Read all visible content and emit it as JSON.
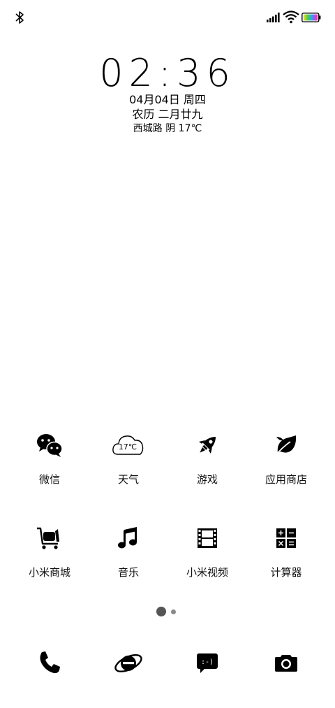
{
  "status_bar": {
    "bluetooth_icon": "bluetooth-icon",
    "signal_icon": "signal-icon",
    "wifi_icon": "wifi-icon",
    "battery_icon": "battery-icon"
  },
  "clock": {
    "time": "02:36",
    "date": "04月04日 周四",
    "lunar": "农历 二月廿九",
    "weather": "西城路 阴 17℃"
  },
  "apps_row1": [
    {
      "label": "微信",
      "icon": "wechat-icon"
    },
    {
      "label": "天气",
      "icon": "weather-cloud-icon",
      "temp": "17℃"
    },
    {
      "label": "游戏",
      "icon": "rocket-icon"
    },
    {
      "label": "应用商店",
      "icon": "leaf-icon"
    }
  ],
  "apps_row2": [
    {
      "label": "小米商城",
      "icon": "cart-icon"
    },
    {
      "label": "音乐",
      "icon": "music-note-icon"
    },
    {
      "label": "小米视频",
      "icon": "film-icon"
    },
    {
      "label": "计算器",
      "icon": "calculator-icon"
    }
  ],
  "page_indicator": {
    "pages": 2,
    "current": 1
  },
  "dock": [
    {
      "icon": "phone-icon"
    },
    {
      "icon": "browser-icon"
    },
    {
      "icon": "message-icon",
      "glyph": ":-)"
    },
    {
      "icon": "camera-icon"
    }
  ],
  "colors": {
    "background": "#ffffff",
    "foreground": "#000000"
  }
}
